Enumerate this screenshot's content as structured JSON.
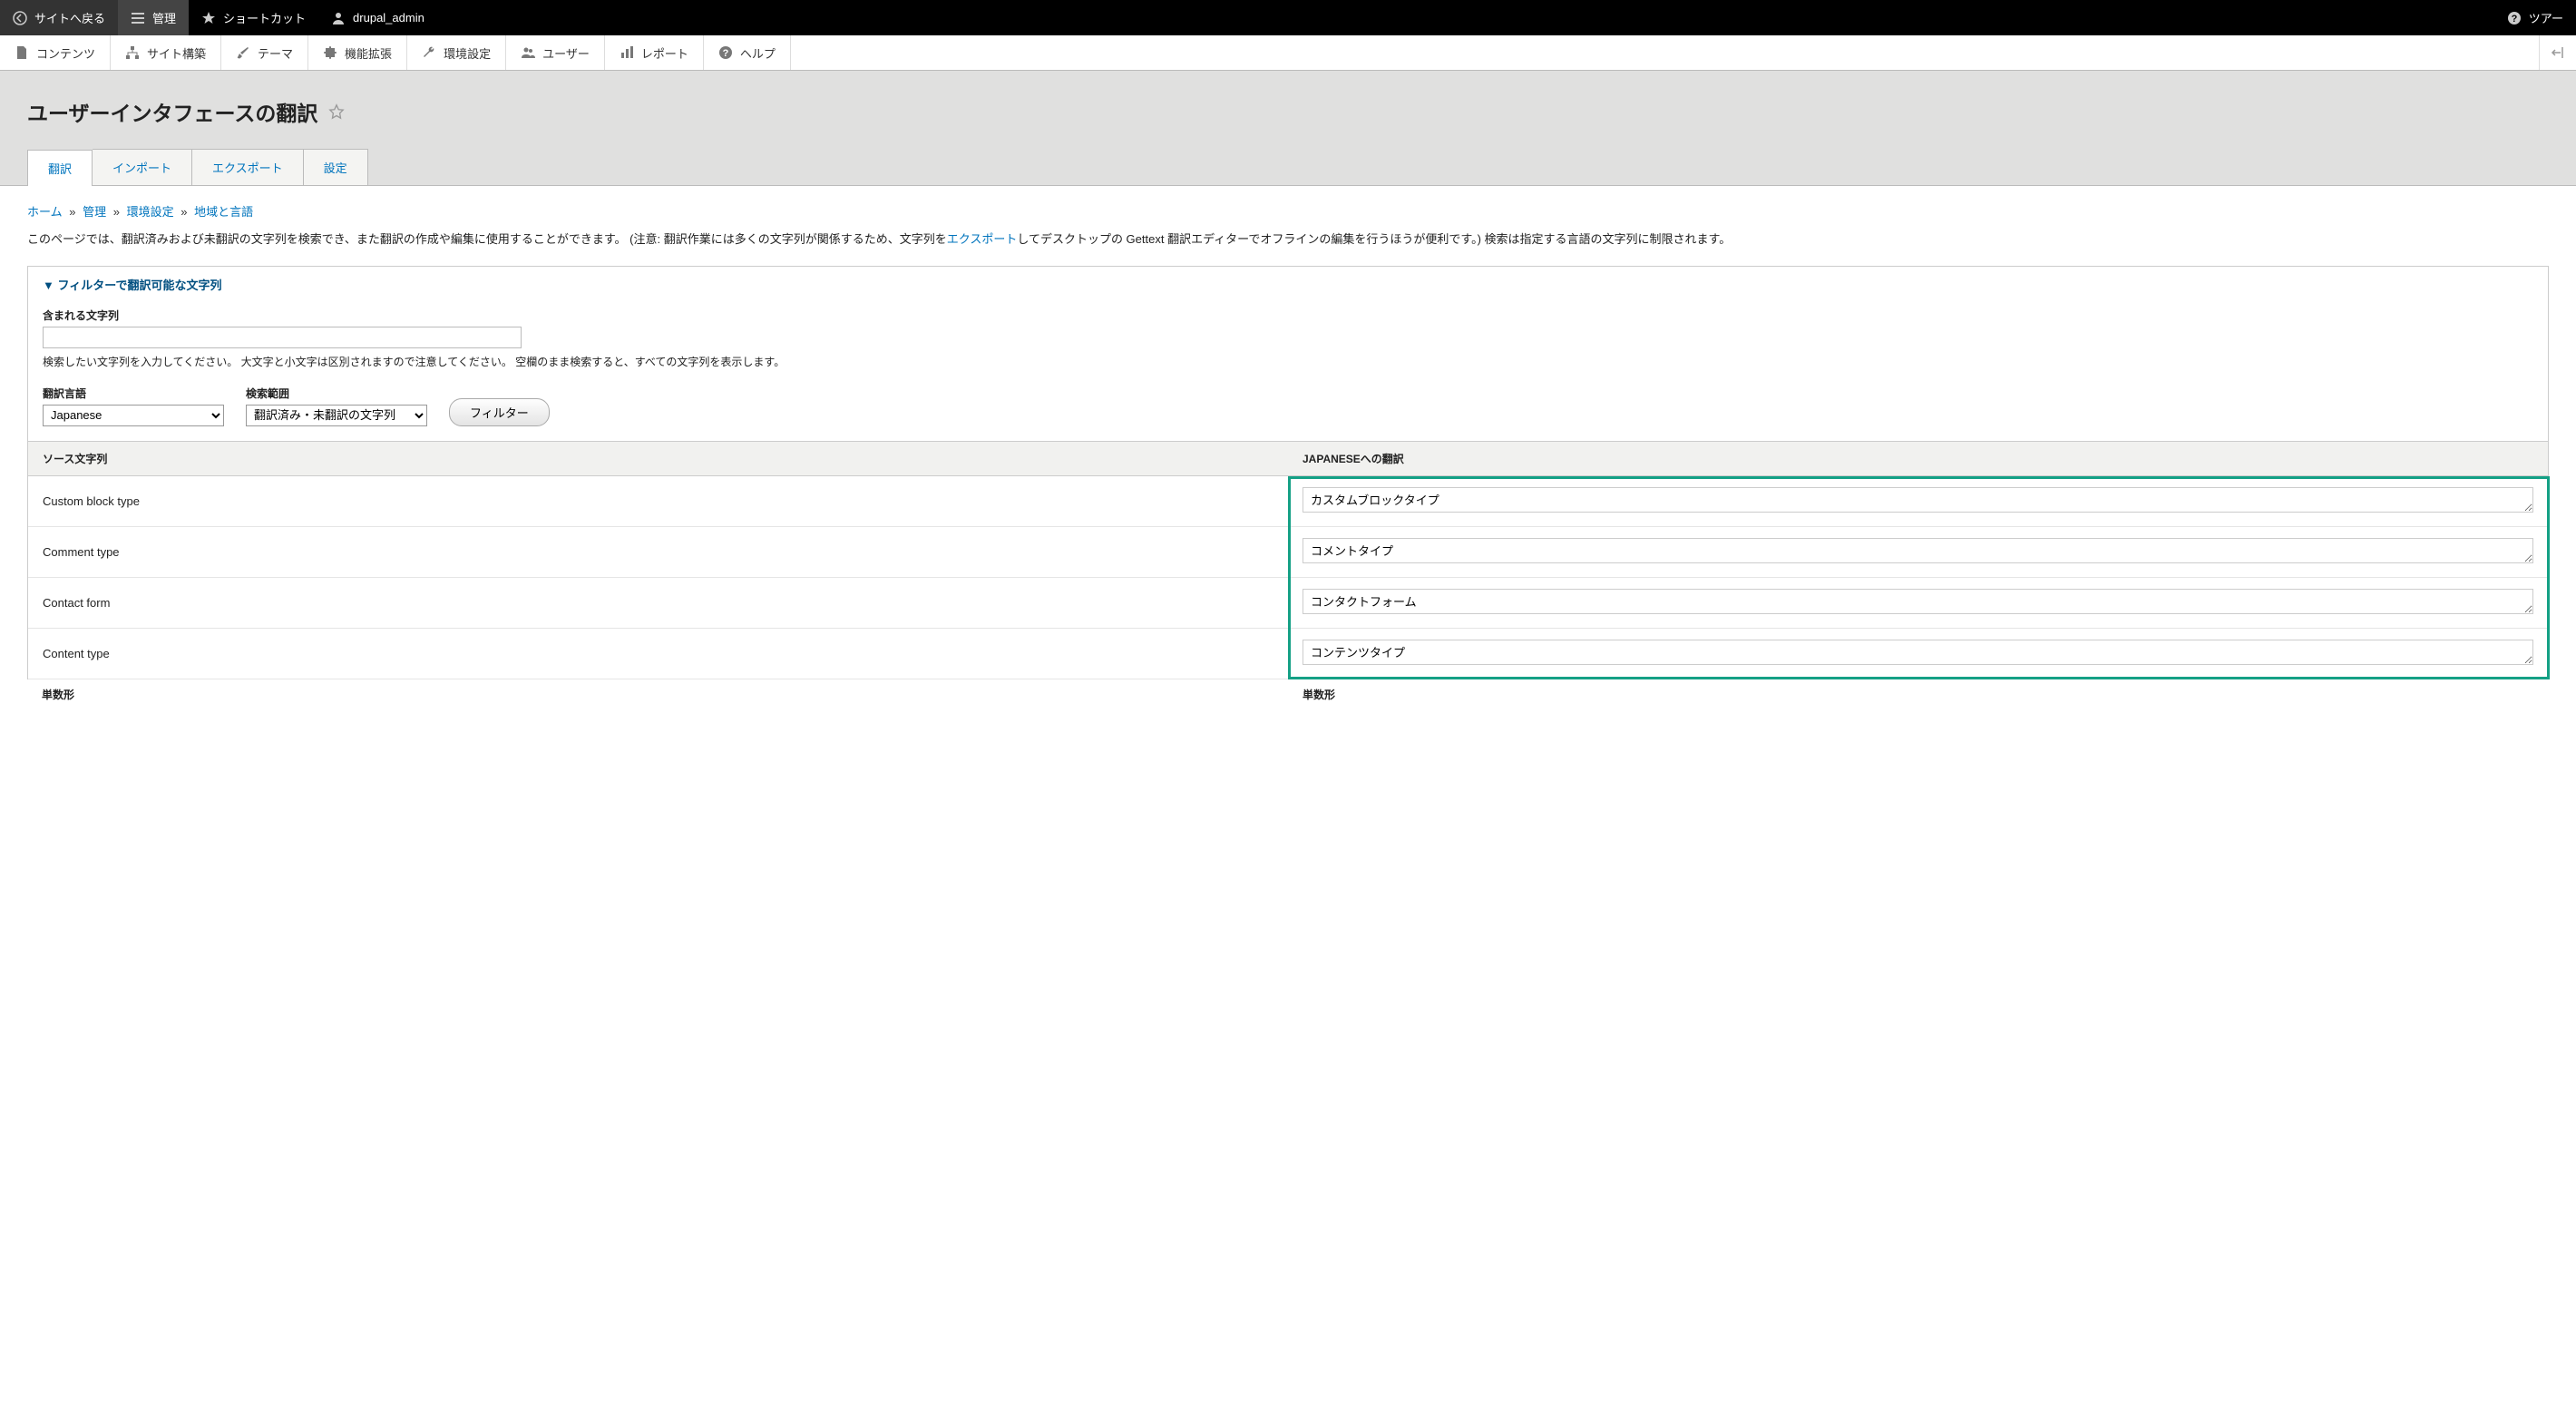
{
  "topbar": {
    "back": "サイトへ戻る",
    "manage": "管理",
    "shortcuts": "ショートカット",
    "user": "drupal_admin",
    "tour": "ツアー"
  },
  "adminbar": {
    "content": "コンテンツ",
    "structure": "サイト構築",
    "appearance": "テーマ",
    "extend": "機能拡張",
    "config": "環境設定",
    "people": "ユーザー",
    "reports": "レポート",
    "help": "ヘルプ"
  },
  "page_title": "ユーザーインタフェースの翻訳",
  "tabs": {
    "translate": "翻訳",
    "import": "インポート",
    "export": "エクスポート",
    "settings": "設定"
  },
  "breadcrumb": {
    "home": "ホーム",
    "admin": "管理",
    "config": "環境設定",
    "regional": "地域と言語"
  },
  "intro_part1": "このページでは、翻訳済みおよび未翻訳の文字列を検索でき、また翻訳の作成や編集に使用することができます。 (注意: 翻訳作業には多くの文字列が関係するため、文字列を",
  "intro_link": "エクスポート",
  "intro_part2": "してデスクトップの Gettext 翻訳エディターでオフラインの編集を行うほうが便利です。) 検索は指定する言語の文字列に制限されます。",
  "filter": {
    "summary": "▼ フィルターで翻訳可能な文字列",
    "contains_label": "含まれる文字列",
    "contains_help": "検索したい文字列を入力してください。 大文字と小文字は区別されますので注意してください。 空欄のまま検索すると、すべての文字列を表示します。",
    "lang_label": "翻訳言語",
    "lang_value": "Japanese",
    "scope_label": "検索範囲",
    "scope_value": "翻訳済み・未翻訳の文字列",
    "button": "フィルター"
  },
  "table": {
    "header_source": "ソース文字列",
    "header_trans": "JAPANESEへの翻訳",
    "rows": [
      {
        "source": "Custom block type",
        "trans": "カスタムブロックタイプ"
      },
      {
        "source": "Comment type",
        "trans": "コメントタイプ"
      },
      {
        "source": "Contact form",
        "trans": "コンタクトフォーム"
      },
      {
        "source": "Content type",
        "trans": "コンテンツタイプ"
      }
    ],
    "subhead": "単数形"
  }
}
